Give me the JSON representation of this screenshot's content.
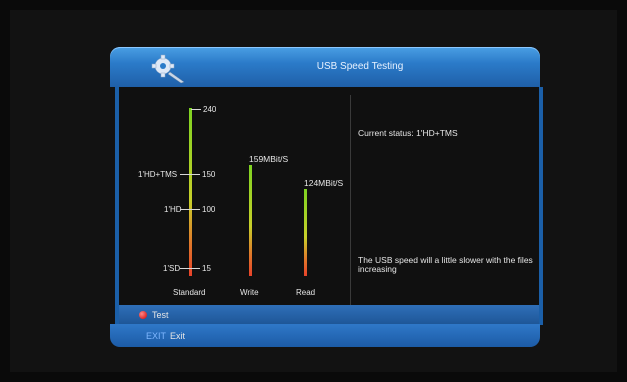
{
  "dialog": {
    "title": "USB Speed Testing",
    "status": "Current status: 1'HD+TMS",
    "note": "The USB speed will a little slower with the files increasing"
  },
  "scale": {
    "max_label": "240",
    "ticks": [
      {
        "label": "1'HD+TMS",
        "value": "150"
      },
      {
        "label": "1'HD",
        "value": "100"
      },
      {
        "label": "1'SD",
        "value": "15"
      }
    ]
  },
  "bars": {
    "standard_label": "Standard",
    "write_label": "Write",
    "read_label": "Read",
    "write_value": "159MBit/S",
    "read_value": "124MBit/S",
    "write_speed": 159,
    "read_speed": 124,
    "max_speed": 240
  },
  "footer": {
    "test_label": "Test",
    "exit_key": "EXIT",
    "exit_label": "Exit"
  },
  "icons": {
    "header_icon": "gear-icon",
    "test_button_icon": "red-dot-icon"
  },
  "colors": {
    "accent_blue": "#2b7bc9",
    "bar_top": "#7ed321",
    "bar_bottom": "#e8422a"
  }
}
